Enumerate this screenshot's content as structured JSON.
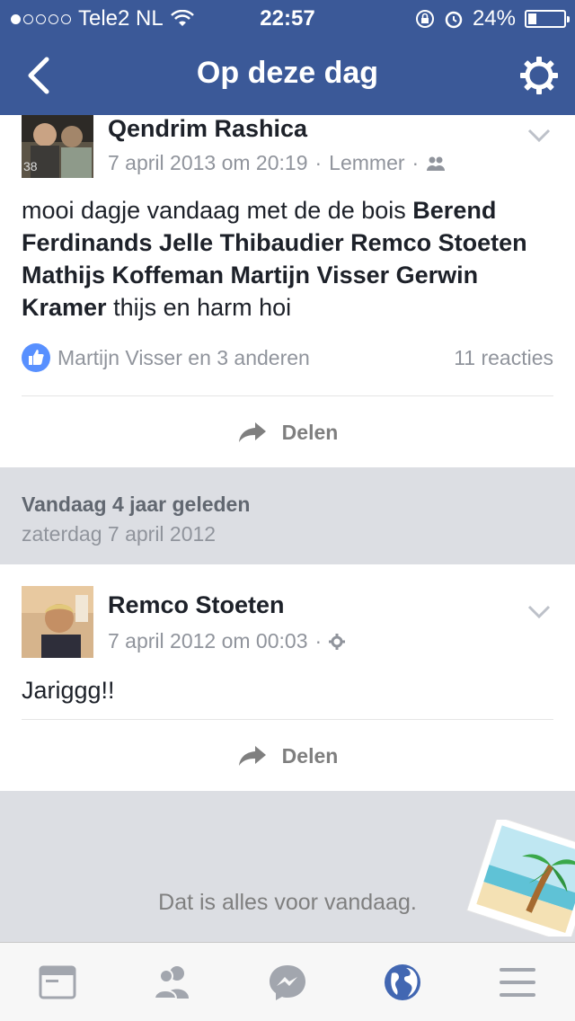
{
  "status_bar": {
    "carrier": "Tele2 NL",
    "time": "22:57",
    "battery": "24%",
    "battery_level": 0.24
  },
  "nav": {
    "title": "Op deze dag"
  },
  "post1": {
    "author": "Qendrim Rashica",
    "date": "7 april 2013 om 20:19",
    "location": "Lemmer",
    "text_parts": [
      {
        "t": "mooi dagje vandaag met de de bois ",
        "bold": false
      },
      {
        "t": "Berend Ferdinands",
        "bold": true
      },
      {
        "t": " ",
        "bold": false
      },
      {
        "t": "Jelle Thibaudier",
        "bold": true
      },
      {
        "t": " ",
        "bold": false
      },
      {
        "t": "Remco Stoeten",
        "bold": true
      },
      {
        "t": " ",
        "bold": false
      },
      {
        "t": "Mathijs Koffeman",
        "bold": true
      },
      {
        "t": " ",
        "bold": false
      },
      {
        "t": "Martijn Visser",
        "bold": true
      },
      {
        "t": " ",
        "bold": false
      },
      {
        "t": "Gerwin Kramer",
        "bold": true
      },
      {
        "t": " thijs en harm hoi",
        "bold": false
      }
    ],
    "likes": "Martijn Visser en 3 anderen",
    "comments": "11 reacties",
    "share_label": "Delen"
  },
  "section": {
    "title": "Vandaag 4 jaar geleden",
    "date": "zaterdag 7 april 2012"
  },
  "post2": {
    "author": "Remco Stoeten",
    "date": "7 april 2012 om 00:03",
    "text": "Jariggg!!",
    "share_label": "Delen"
  },
  "footer": {
    "end_text": "Dat is alles voor vandaag."
  },
  "tabs": [
    {
      "name": "news-feed-icon"
    },
    {
      "name": "friends-icon"
    },
    {
      "name": "messenger-icon"
    },
    {
      "name": "notifications-globe-icon"
    },
    {
      "name": "menu-icon"
    }
  ],
  "colors": {
    "brand": "#3b5998",
    "like_blue": "#5890ff",
    "active_tab": "#4267b2"
  }
}
